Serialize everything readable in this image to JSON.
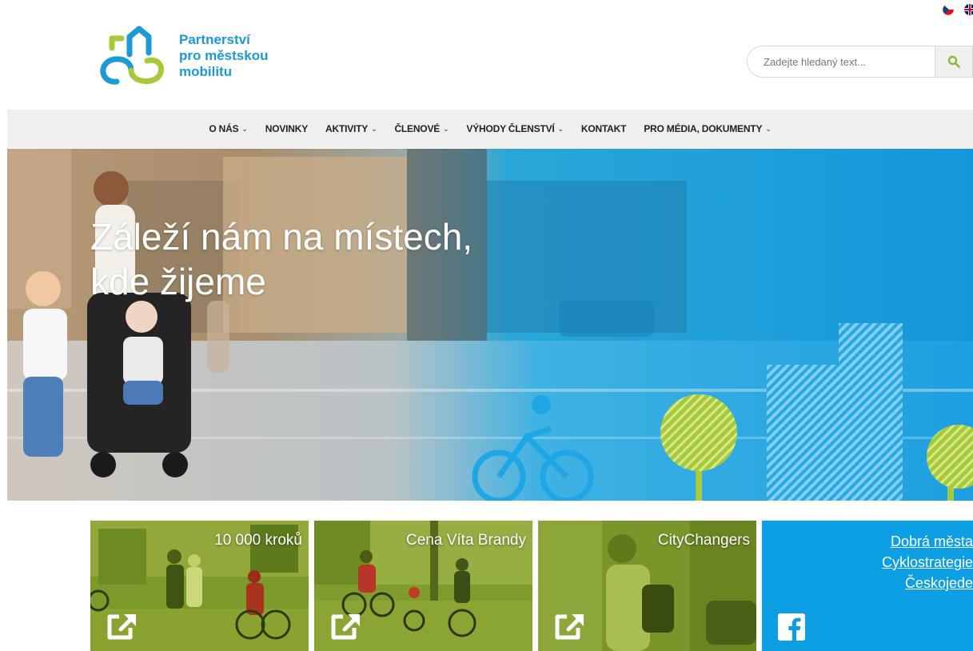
{
  "header": {
    "logo_text": [
      "Partnerství",
      "pro městskou",
      "mobilitu"
    ]
  },
  "search": {
    "placeholder": "Zadejte hledaný text..."
  },
  "nav": {
    "items": [
      {
        "label": "O NÁS",
        "dropdown": true
      },
      {
        "label": "NOVINKY",
        "dropdown": false
      },
      {
        "label": "AKTIVITY",
        "dropdown": true
      },
      {
        "label": "ČLENOVÉ",
        "dropdown": true
      },
      {
        "label": "VÝHODY ČLENSTVÍ",
        "dropdown": true
      },
      {
        "label": "KONTAKT",
        "dropdown": false
      },
      {
        "label": "PRO MÉDIA, DOKUMENTY",
        "dropdown": true
      }
    ]
  },
  "hero": {
    "title_line1": "Záleží nám na místech,",
    "title_line2": "kde žijeme"
  },
  "tiles": [
    {
      "title": "10 000 kroků",
      "icon": "external-link-icon"
    },
    {
      "title": "Cena Víta Brandy",
      "icon": "external-link-icon"
    },
    {
      "title": "CityChangers",
      "icon": "external-link-icon"
    }
  ],
  "facebook_tile": {
    "links": [
      "Dobrá města",
      "Cyklostrategie",
      "Českojede"
    ],
    "icon": "facebook-icon"
  },
  "colors": {
    "brand_blue": "#1c9ad6",
    "accent_green": "#a7c93a",
    "tile_blue": "#0d9fe3",
    "nav_bg": "#efefef"
  }
}
